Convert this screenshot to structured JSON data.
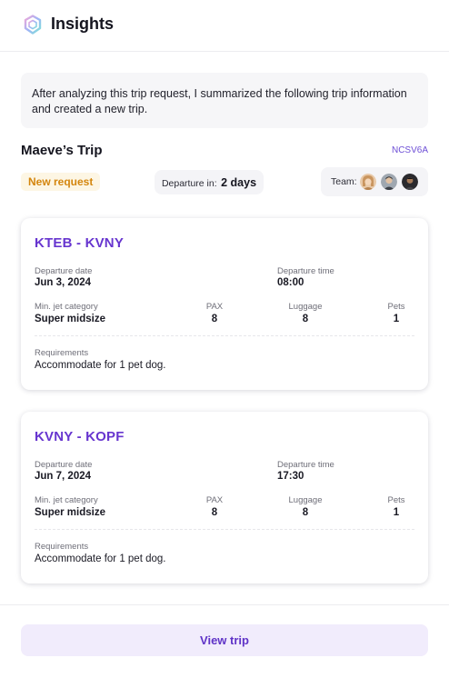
{
  "app": {
    "title": "Insights"
  },
  "summary": {
    "text": "After analyzing this trip request, I summarized the following trip information and created a new trip."
  },
  "trip": {
    "name": "Maeve’s Trip",
    "code": "NCSV6A",
    "status": "New request",
    "departure_label": "Departure in:",
    "departure_value": "2 days",
    "team_label": "Team:"
  },
  "legs": [
    {
      "route": "KTEB - KVNY",
      "departure_date_label": "Departure date",
      "departure_date": "Jun 3, 2024",
      "departure_time_label": "Departure time",
      "departure_time": "08:00",
      "jet_label": "Min. jet category",
      "jet": "Super midsize",
      "pax_label": "PAX",
      "pax": "8",
      "luggage_label": "Luggage",
      "luggage": "8",
      "pets_label": "Pets",
      "pets": "1",
      "requirements_label": "Requirements",
      "requirements": "Accommodate for 1 pet dog."
    },
    {
      "route": "KVNY - KOPF",
      "departure_date_label": "Departure date",
      "departure_date": "Jun 7, 2024",
      "departure_time_label": "Departure time",
      "departure_time": "17:30",
      "jet_label": "Min. jet category",
      "jet": "Super midsize",
      "pax_label": "PAX",
      "pax": "8",
      "luggage_label": "Luggage",
      "luggage": "8",
      "pets_label": "Pets",
      "pets": "1",
      "requirements_label": "Requirements",
      "requirements": "Accommodate for 1 pet dog."
    }
  ],
  "actions": {
    "view_trip": "View trip"
  },
  "colors": {
    "accent": "#6735cf",
    "status_text": "#d4860e",
    "status_bg": "#fdf6e4",
    "button_bg": "#f1ecfc"
  }
}
